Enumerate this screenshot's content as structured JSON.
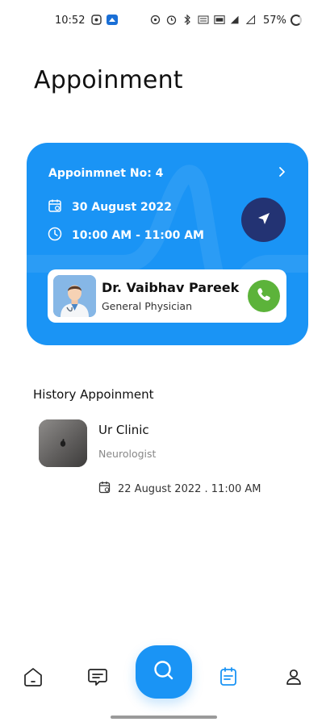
{
  "status_bar": {
    "time": "10:52",
    "battery": "57%"
  },
  "page": {
    "title": "Appoinment"
  },
  "current_appointment": {
    "number_label": "Appoinmnet No: 4",
    "date": "30 August 2022",
    "time": "10:00 AM - 11:00 AM",
    "doctor": {
      "name": "Dr. Vaibhav Pareek",
      "specialty": "General Physician"
    }
  },
  "history": {
    "heading": "History Appoinment",
    "items": [
      {
        "name": "Ur Clinic",
        "specialty": "Neurologist",
        "datetime": "22 August 2022 . 11:00 AM"
      }
    ]
  },
  "bottom_nav": {
    "items": [
      "home-icon",
      "chat-icon",
      "search-icon",
      "calendar-icon",
      "profile-icon"
    ],
    "active": "calendar-icon"
  },
  "colors": {
    "primary": "#1a94f5",
    "navy": "#233373",
    "call_green": "#5cb33a"
  }
}
